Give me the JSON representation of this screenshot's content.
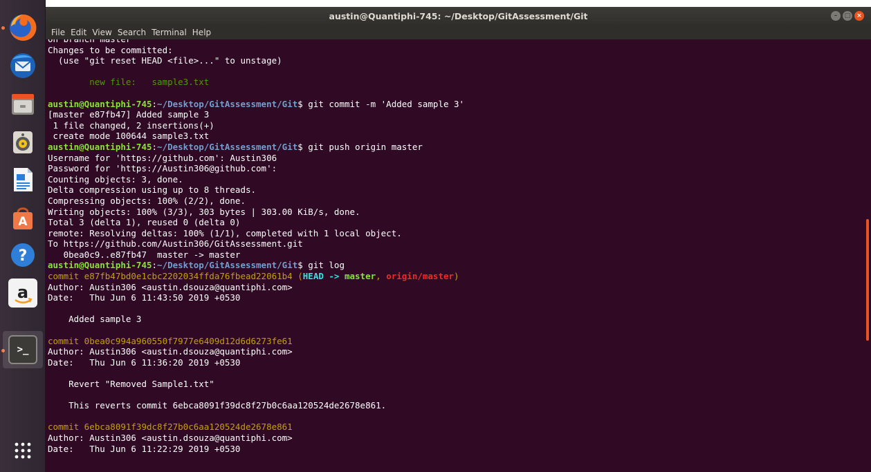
{
  "window": {
    "title": "austin@Quantiphi-745: ~/Desktop/GitAssessment/Git",
    "menu": [
      "File",
      "Edit",
      "View",
      "Search",
      "Terminal",
      "Help"
    ]
  },
  "launcher": [
    {
      "name": "firefox-icon",
      "running": true
    },
    {
      "name": "thunderbird-icon",
      "running": false
    },
    {
      "name": "files-icon",
      "running": false
    },
    {
      "name": "rhythmbox-icon",
      "running": false
    },
    {
      "name": "libreoffice-writer-icon",
      "running": false
    },
    {
      "name": "software-center-icon",
      "running": false
    },
    {
      "name": "help-icon",
      "running": false,
      "glyph": "?"
    },
    {
      "name": "amazon-icon",
      "running": false,
      "glyph": "a"
    },
    {
      "name": "terminal-icon",
      "running": true,
      "glyph": ">_"
    },
    {
      "name": "show-apps-icon",
      "running": false
    }
  ],
  "prompt": {
    "user": "austin@Quantiphi-745",
    "path": "~/Desktop/GitAssessment/Git",
    "symbol": "$"
  },
  "terminal_lines": [
    [
      {
        "t": "On branch master",
        "c": ""
      }
    ],
    [
      {
        "t": "Changes to be committed:",
        "c": ""
      }
    ],
    [
      {
        "t": "  (use \"git reset HEAD <file>...\" to unstage)",
        "c": ""
      }
    ],
    [
      {
        "t": "",
        "c": ""
      }
    ],
    [
      {
        "t": "        new file:   sample3.txt",
        "c": "grn"
      }
    ],
    [
      {
        "t": "",
        "c": ""
      }
    ],
    [
      {
        "t": "austin@Quantiphi-745",
        "c": "g"
      },
      {
        "t": ":",
        "c": ""
      },
      {
        "t": "~/Desktop/GitAssessment/Git",
        "c": "b"
      },
      {
        "t": "$ git commit -m 'Added sample 3'",
        "c": ""
      }
    ],
    [
      {
        "t": "[master e87fb47] Added sample 3",
        "c": ""
      }
    ],
    [
      {
        "t": " 1 file changed, 2 insertions(+)",
        "c": ""
      }
    ],
    [
      {
        "t": " create mode 100644 sample3.txt",
        "c": ""
      }
    ],
    [
      {
        "t": "austin@Quantiphi-745",
        "c": "g"
      },
      {
        "t": ":",
        "c": ""
      },
      {
        "t": "~/Desktop/GitAssessment/Git",
        "c": "b"
      },
      {
        "t": "$ git push origin master",
        "c": ""
      }
    ],
    [
      {
        "t": "Username for 'https://github.com': Austin306",
        "c": ""
      }
    ],
    [
      {
        "t": "Password for 'https://Austin306@github.com':",
        "c": ""
      }
    ],
    [
      {
        "t": "Counting objects: 3, done.",
        "c": ""
      }
    ],
    [
      {
        "t": "Delta compression using up to 8 threads.",
        "c": ""
      }
    ],
    [
      {
        "t": "Compressing objects: 100% (2/2), done.",
        "c": ""
      }
    ],
    [
      {
        "t": "Writing objects: 100% (3/3), 303 bytes | 303.00 KiB/s, done.",
        "c": ""
      }
    ],
    [
      {
        "t": "Total 3 (delta 1), reused 0 (delta 0)",
        "c": ""
      }
    ],
    [
      {
        "t": "remote: Resolving deltas: 100% (1/1), completed with 1 local object.",
        "c": ""
      }
    ],
    [
      {
        "t": "To https://github.com/Austin306/GitAssessment.git",
        "c": ""
      }
    ],
    [
      {
        "t": "   0bea0c9..e87fb47  master -> master",
        "c": ""
      }
    ],
    [
      {
        "t": "austin@Quantiphi-745",
        "c": "g"
      },
      {
        "t": ":",
        "c": ""
      },
      {
        "t": "~/Desktop/GitAssessment/Git",
        "c": "b"
      },
      {
        "t": "$ git log",
        "c": ""
      }
    ],
    [
      {
        "t": "commit e87fb47bd0e1cbc2202034ffda76fbead22061b4 (",
        "c": "y"
      },
      {
        "t": "HEAD -> ",
        "c": "cy"
      },
      {
        "t": "master",
        "c": "gn"
      },
      {
        "t": ", ",
        "c": "y"
      },
      {
        "t": "origin/master",
        "c": "rd"
      },
      {
        "t": ")",
        "c": "y"
      }
    ],
    [
      {
        "t": "Author: Austin306 <austin.dsouza@quantiphi.com>",
        "c": ""
      }
    ],
    [
      {
        "t": "Date:   Thu Jun 6 11:43:50 2019 +0530",
        "c": ""
      }
    ],
    [
      {
        "t": "",
        "c": ""
      }
    ],
    [
      {
        "t": "    Added sample 3",
        "c": ""
      }
    ],
    [
      {
        "t": "",
        "c": ""
      }
    ],
    [
      {
        "t": "commit 0bea0c994a960550f7977e6409d12d6d6273fe61",
        "c": "y"
      }
    ],
    [
      {
        "t": "Author: Austin306 <austin.dsouza@quantiphi.com>",
        "c": ""
      }
    ],
    [
      {
        "t": "Date:   Thu Jun 6 11:36:20 2019 +0530",
        "c": ""
      }
    ],
    [
      {
        "t": "",
        "c": ""
      }
    ],
    [
      {
        "t": "    Revert \"Removed Sample1.txt\"",
        "c": ""
      }
    ],
    [
      {
        "t": "",
        "c": ""
      }
    ],
    [
      {
        "t": "    This reverts commit 6ebca8091f39dc8f27b0c6aa120524de2678e861.",
        "c": ""
      }
    ],
    [
      {
        "t": "",
        "c": ""
      }
    ],
    [
      {
        "t": "commit 6ebca8091f39dc8f27b0c6aa120524de2678e861",
        "c": "y"
      }
    ],
    [
      {
        "t": "Author: Austin306 <austin.dsouza@quantiphi.com>",
        "c": ""
      }
    ],
    [
      {
        "t": "Date:   Thu Jun 6 11:22:29 2019 +0530",
        "c": ""
      }
    ]
  ]
}
